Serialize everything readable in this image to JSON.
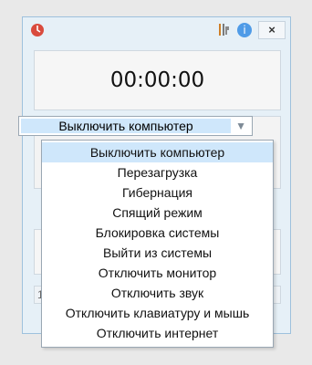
{
  "titlebar": {
    "tools_icon": "tools-icon",
    "help_icon": "help-icon",
    "close_label": "×"
  },
  "timer": {
    "display": "00:00:00"
  },
  "action_select": {
    "selected_value": "Выключить компьютер",
    "arrow": "▼",
    "options": [
      "Выключить компьютер",
      "Перезагрузка",
      "Гибернация",
      "Спящий режим",
      "Блокировка системы",
      "Выйти из системы",
      "Отключить монитор",
      "Отключить звук",
      "Отключить клавиатуру и мышь",
      "Отключить интернет"
    ]
  },
  "bottom_strip": {
    "visible_label": "1"
  }
}
